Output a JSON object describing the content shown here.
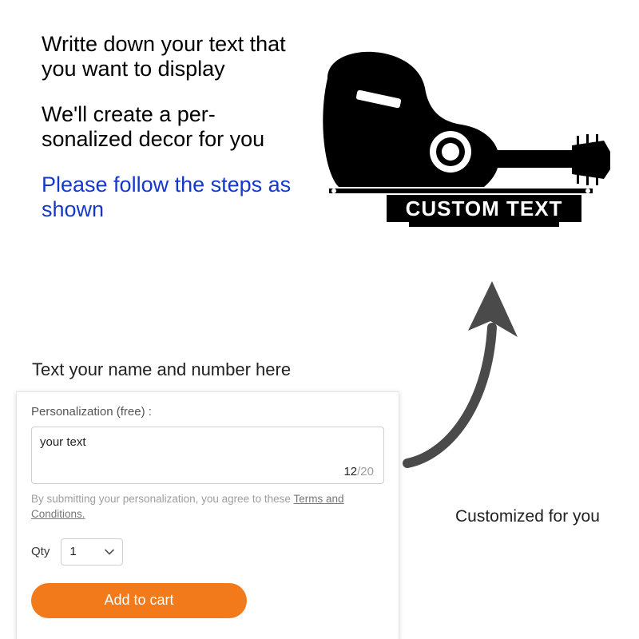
{
  "instructions": {
    "line1": "Writte down your text that you want to display",
    "line2": "We'll create a per­sonalized decor for you",
    "line3": "Please follow the steps as shown"
  },
  "product": {
    "custom_text_label": "CUSTOM TEXT"
  },
  "caption_input": "Text your name and number here",
  "caption_output": "Customized for you",
  "panel": {
    "label": "Personalization (free) :",
    "input_value": "your text",
    "input_placeholder": "",
    "char_count": "12",
    "char_max": "/20",
    "disclaimer_prefix": "By submitting your personalization, you agree to these ",
    "disclaimer_link": "Terms and Conditions.",
    "qty_label": "Qty",
    "qty_value": "1",
    "add_to_cart": "Add to cart"
  }
}
